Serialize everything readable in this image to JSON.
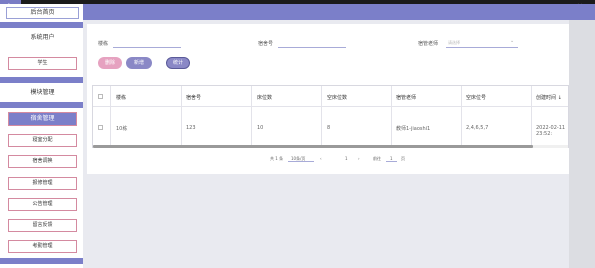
{
  "window": {
    "back": "←",
    "minimize": "—",
    "maximize": "▢",
    "close": "✕"
  },
  "sidebar": {
    "home": "后台首页",
    "groups": [
      {
        "label": "系统用户",
        "items": [
          "学生"
        ]
      },
      {
        "label": "模块管理",
        "items": [
          "宿舍管理",
          "寝室分配",
          "宿舍调换",
          "报修管理",
          "公告管理",
          "留言反馈",
          "考勤管理"
        ]
      }
    ]
  },
  "search": {
    "fields": [
      {
        "label": "楼栋",
        "value": ""
      },
      {
        "label": "宿舍号",
        "value": ""
      },
      {
        "label": "宿管老师",
        "placeholder": "请选择"
      }
    ]
  },
  "actions": {
    "delete": "删除",
    "add": "新增",
    "stats": "统计"
  },
  "table": {
    "columns": [
      "楼栋",
      "宿舍号",
      "床位数",
      "空床位数",
      "宿管老师",
      "空床位号",
      "创建时间 ↓"
    ],
    "rows": [
      [
        "10栋",
        "123",
        "10",
        "8",
        "教师1-jiaoshi1",
        "2,4,6,5,7",
        "2022-02-11 23:52:"
      ]
    ]
  },
  "pagination": {
    "total": "共 1 条",
    "page_size": "10条/页",
    "prev": "‹",
    "page": "1",
    "next": "›",
    "goto": "前往",
    "goto_value": "1",
    "goto_suffix": "页"
  }
}
